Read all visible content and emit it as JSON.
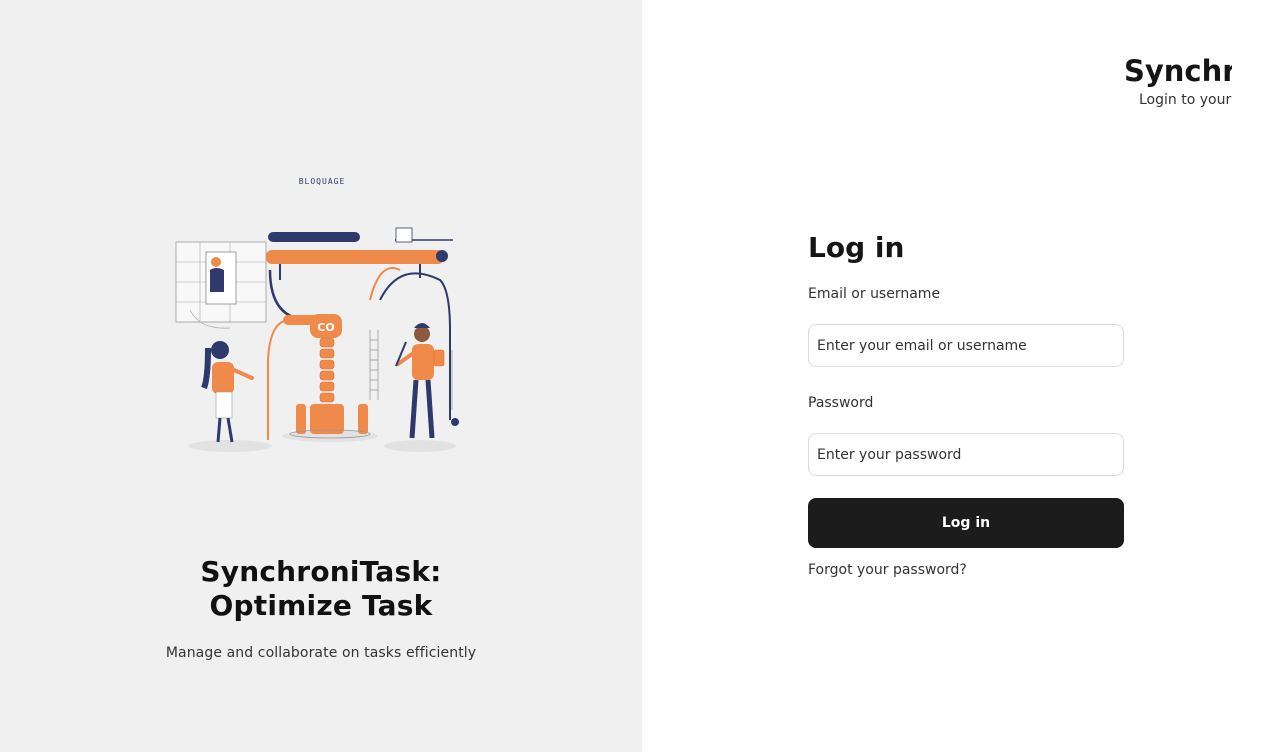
{
  "left": {
    "illustration_caption": "BLOQUAGE",
    "brand_title_line1": "SynchroniTask:",
    "brand_title_line2": "Optimize Task",
    "brand_subtitle": "Manage and collaborate on tasks efficiently"
  },
  "header": {
    "title": "Synchro",
    "subtitle": "Login to your"
  },
  "form": {
    "heading": "Log in",
    "email_label": "Email or username",
    "email_placeholder": "Enter your email or username",
    "password_label": "Password",
    "password_placeholder": "Enter your password",
    "login_label": "Log in",
    "forgot_label": "Forgot your password?"
  },
  "colors": {
    "left_bg": "#f0f0f0",
    "button_bg": "#1c1c1c",
    "accent_orange": "#f08a4b",
    "accent_navy": "#2e3a6b"
  }
}
